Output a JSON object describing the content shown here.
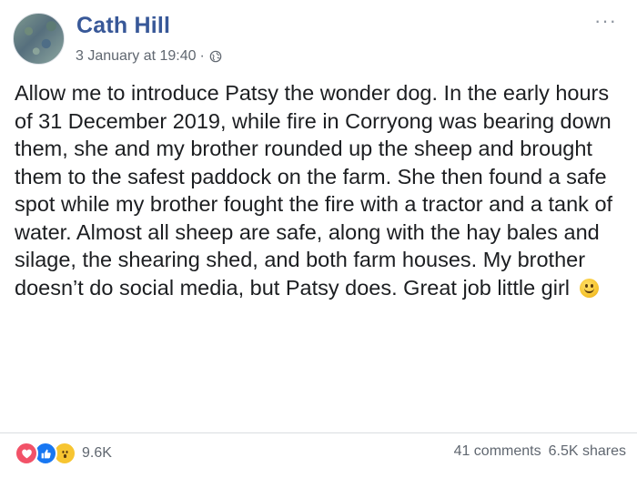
{
  "post": {
    "author": "Cath Hill",
    "timestamp": "3 January at 19:40",
    "separator": "·",
    "privacy_icon": "globe-icon",
    "more_label": "···",
    "body": "Allow me to introduce Patsy the wonder dog. In the early hours of 31 December 2019, while fire in Corryong was bearing down them, she and my brother rounded up the sheep and brought them to the safest paddock on the farm. She then found a safe spot while my brother fought the fire with a tractor and a tank of water. Almost all sheep are safe, along with the hay bales and silage, the shearing shed, and both farm houses. My brother doesn’t do social media, but Patsy does. Great job little girl",
    "emoji": "smiley-emoji-icon"
  },
  "footer": {
    "reactions": [
      "love-reaction-icon",
      "like-reaction-icon",
      "wow-reaction-icon"
    ],
    "reaction_count": "9.6K",
    "comments": "41 comments",
    "shares": "6.5K shares"
  },
  "colors": {
    "author": "#385898",
    "meta": "#606770",
    "text": "#1c1e21",
    "love": "#f25268",
    "like": "#1877f2",
    "wow": "#f7c531"
  }
}
